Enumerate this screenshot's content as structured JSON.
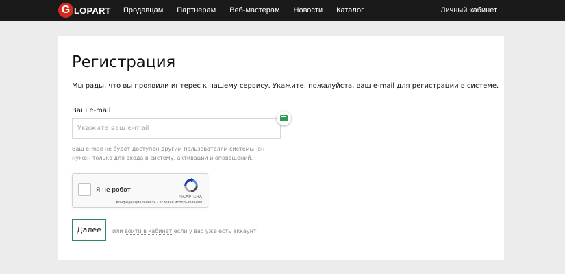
{
  "header": {
    "logo": {
      "letter": "G",
      "text": "LOPART"
    },
    "nav": [
      "Продавцам",
      "Партнерам",
      "Веб-мастерам",
      "Новости",
      "Каталог"
    ],
    "cabinet": "Личный кабинет"
  },
  "form": {
    "title": "Регистрация",
    "intro": "Мы рады, что вы проявили интерес к нашему сервису. Укажите, пожалуйста, ваш e-mail для регистрации в системе.",
    "email_label": "Ваш e-mail",
    "email_placeholder": "Укажите ваш e-mail",
    "email_value": "",
    "hint": "Ваш e-mail не будет доступен другим пользователям системы, он нужен только для входа в систему, активации и оповещений.",
    "captcha": {
      "label": "Я не робот",
      "brand": "reCAPTCHA",
      "links": "Конфиденциальность - Условия использования",
      "checked": false
    },
    "submit": "Далее",
    "alt_prefix": "или",
    "alt_link": "войти в кабинет",
    "alt_suffix": "если у вас уже есть аккаунт"
  },
  "colors": {
    "topbar": "#1a1a1a",
    "logo": "#d52b1e",
    "accent": "#2e8b57",
    "background": "#ececec"
  },
  "icons": {
    "extension": "password-manager-icon",
    "captcha": "recaptcha-logo"
  }
}
